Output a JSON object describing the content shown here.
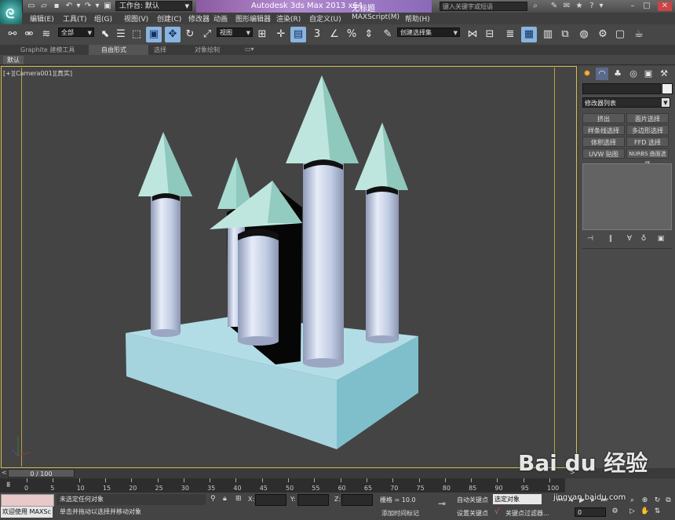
{
  "titlebar": {
    "workspace_label": "工作台: 默认",
    "app_title": "Autodesk 3ds Max  2013 x64",
    "file_name": "无标题",
    "search_placeholder": "键入关键字或短语"
  },
  "menu": [
    "编辑(E)",
    "工具(T)",
    "组(G)",
    "视图(V)",
    "创建(C)",
    "修改器",
    "动画",
    "图形编辑器",
    "渲染(R)",
    "自定义(U)",
    "MAXScript(M)",
    "帮助(H)"
  ],
  "toolbar": {
    "selection_filter": "全部",
    "ref_coord": "视图",
    "named_selection": "创建选择集",
    "snap_label": "3",
    "angle_snap": "n",
    "percent_snap": "%"
  },
  "ribbon": {
    "tabs": [
      "Graphite 建模工具",
      "自由形式",
      "选择",
      "对象绘制"
    ],
    "active_tab": "自由形式",
    "sub_tab": "默认"
  },
  "viewport": {
    "label": "[+][Camera001][",
    "shading": "真实",
    "label_end": "]"
  },
  "command_panel": {
    "modifier_list": "修改器列表",
    "modifier_buttons": [
      "挤出",
      "面片选择",
      "样条线选择",
      "多边形选择",
      "体积选择",
      "FFD 选择",
      "UVW 贴图",
      "NURBS 曲面选择"
    ]
  },
  "timeline": {
    "slider_text": "0 / 100",
    "ticks": [
      "0",
      "5",
      "10",
      "15",
      "20",
      "25",
      "30",
      "35",
      "40",
      "45",
      "50",
      "55",
      "60",
      "65",
      "70",
      "75",
      "80",
      "85",
      "90",
      "95",
      "100"
    ]
  },
  "statusbar": {
    "welcome": "欢迎使用 MAXSc",
    "status_line1": "未选定任何对象",
    "status_line2": "单击并拖动以选择并移动对象",
    "x_label": "X:",
    "y_label": "Y:",
    "z_label": "Z:",
    "grid": "栅格 = 10.0",
    "add_time_tag": "添加时间标记",
    "auto_key": "自动关键点",
    "set_key": "设置关键点",
    "selection_set": "选定对象",
    "key_filter": "关键点过滤器...",
    "frame": "0"
  },
  "watermark": {
    "brand": "Bai  du 经验",
    "url": "jingyan.baidu.com"
  },
  "colors": {
    "viewport_bg": "#444444",
    "viewport_border": "#d0c050",
    "base_top": "#b3dde6",
    "base_side": "#7fbfcc",
    "cone": "#a8dcd2",
    "tower": "#c8d4ea"
  }
}
